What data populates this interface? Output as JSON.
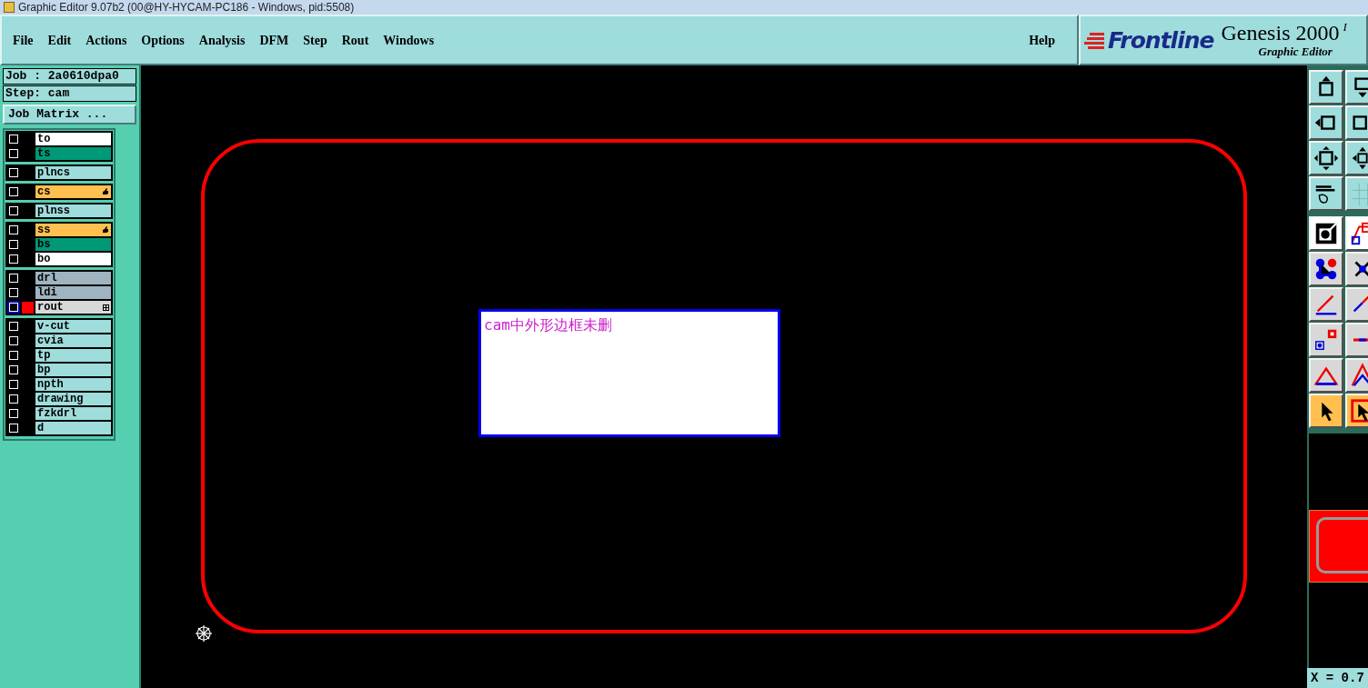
{
  "window": {
    "title": "Graphic Editor 9.07b2 (00@HY-HYCAM-PC186 - Windows, pid:5508)"
  },
  "menu": [
    "File",
    "Edit",
    "Actions",
    "Options",
    "Analysis",
    "DFM",
    "Step",
    "Rout",
    "Windows"
  ],
  "help": "Help",
  "brand": {
    "logo": "Frontline",
    "product": "Genesis 2000",
    "product_suffix": "I",
    "subtitle": "Graphic Editor"
  },
  "job": {
    "job": "Job : 2a0610dpa0",
    "step": "Step: cam",
    "matrix_button": "Job Matrix ..."
  },
  "layer_groups": [
    {
      "layers": [
        {
          "name": "to",
          "color": "#ffffff",
          "affected": false,
          "selected": false
        },
        {
          "name": "ts",
          "color": "#009977",
          "affected": false,
          "selected": false
        }
      ]
    },
    {
      "layers": [
        {
          "name": "plncs",
          "color": "#9fdcdc",
          "affected": false,
          "selected": false
        }
      ]
    },
    {
      "layers": [
        {
          "name": "cs",
          "color": "#ffc050",
          "affected": false,
          "selected": false,
          "kind": "hand"
        }
      ]
    },
    {
      "layers": [
        {
          "name": "plnss",
          "color": "#9fdcdc",
          "affected": false,
          "selected": false
        }
      ]
    },
    {
      "layers": [
        {
          "name": "ss",
          "color": "#ffc050",
          "affected": false,
          "selected": false,
          "kind": "hand"
        },
        {
          "name": "bs",
          "color": "#009977",
          "affected": false,
          "selected": false
        },
        {
          "name": "bo",
          "color": "#ffffff",
          "affected": false,
          "selected": false
        }
      ]
    },
    {
      "layers": [
        {
          "name": "drl",
          "color": "#9fb4c0",
          "affected": false,
          "selected": false
        },
        {
          "name": "ldi",
          "color": "#9fb4c0",
          "affected": false,
          "selected": false
        },
        {
          "name": "rout",
          "color": "#d8d8d8",
          "affected": false,
          "selected": true,
          "kind": "grid"
        }
      ]
    },
    {
      "layers": [
        {
          "name": "v-cut",
          "color": "#9fdcdc",
          "affected": false,
          "selected": false
        },
        {
          "name": "cvia",
          "color": "#9fdcdc",
          "affected": false,
          "selected": false
        },
        {
          "name": "tp",
          "color": "#9fdcdc",
          "affected": false,
          "selected": false
        },
        {
          "name": "bp",
          "color": "#9fdcdc",
          "affected": false,
          "selected": false
        },
        {
          "name": "npth",
          "color": "#9fdcdc",
          "affected": false,
          "selected": false
        },
        {
          "name": "drawing",
          "color": "#9fdcdc",
          "affected": false,
          "selected": false
        },
        {
          "name": "fzkdrl",
          "color": "#9fdcdc",
          "affected": false,
          "selected": false
        },
        {
          "name": "d",
          "color": "#9fdcdc",
          "affected": false,
          "selected": false
        }
      ]
    }
  ],
  "canvas": {
    "note": "cam中外形边框未删"
  },
  "status": {
    "coordinate": "X = 0.7"
  }
}
